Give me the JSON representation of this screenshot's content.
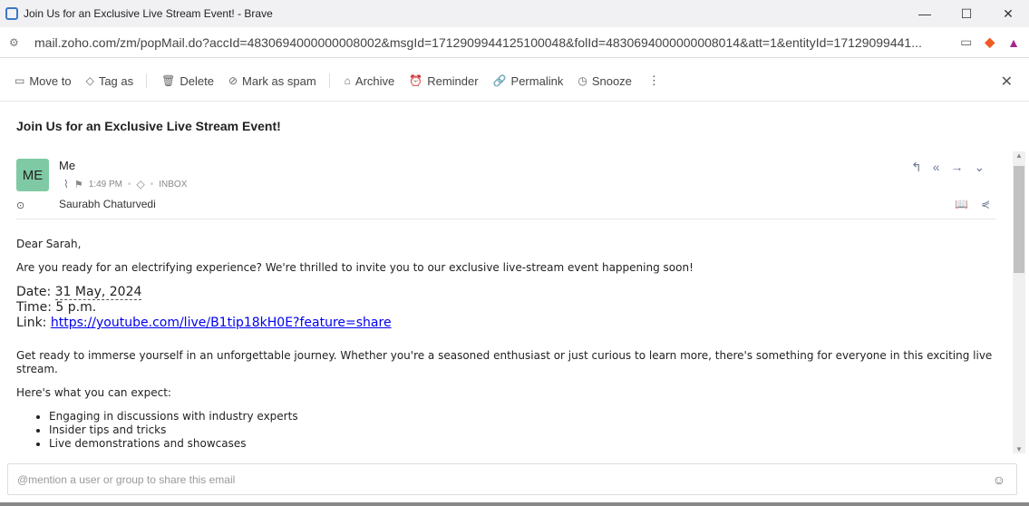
{
  "window": {
    "title": "Join Us for an Exclusive Live Stream Event! - Brave",
    "minimize": "—",
    "maximize": "☐",
    "close": "✕"
  },
  "address": {
    "url": "mail.zoho.com/zm/popMail.do?accId=4830694000000008002&msgId=1712909944125100048&folId=4830694000000008014&att=1&entityId=17129099441..."
  },
  "toolbar": {
    "move_to": "Move to",
    "tag_as": "Tag as",
    "delete": "Delete",
    "mark_spam": "Mark as spam",
    "archive": "Archive",
    "reminder": "Reminder",
    "permalink": "Permalink",
    "snooze": "Snooze"
  },
  "email": {
    "subject": "Join Us for an Exclusive Live Stream Event!",
    "avatar": "ME",
    "from": "Me",
    "time": "1:49 PM",
    "folder": "INBOX",
    "to": "Saurabh Chaturvedi",
    "greeting": "Dear Sarah,",
    "intro": "Are you ready for an electrifying experience? We're thrilled to invite you to our exclusive live-stream event happening soon!",
    "date_label": "Date: ",
    "date": "31 May, 2024",
    "time_line": "Time: 5 p.m.",
    "link_label": "Link: ",
    "link": "https://youtube.com/live/B1tip18kH0E?feature=share",
    "para": "Get ready to immerse yourself in an unforgettable journey. Whether you're a seasoned enthusiast or just curious to learn more, there's something for everyone in this exciting live stream.",
    "expect": "Here's what you can expect:",
    "items": [
      "Engaging in discussions with industry experts",
      "Insider tips and tricks",
      "Live demonstrations and showcases"
    ]
  },
  "compose": {
    "placeholder": "@mention a user or group to share this email"
  }
}
